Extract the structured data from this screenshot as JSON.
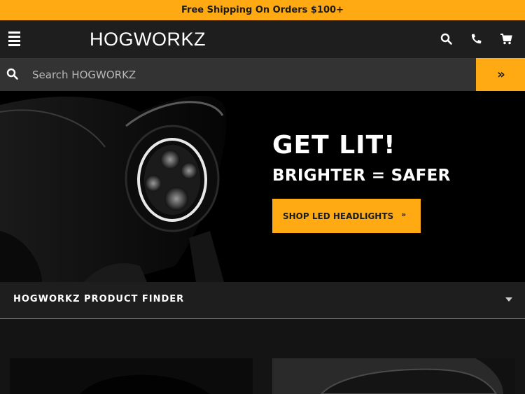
{
  "promo": {
    "text": "Free Shipping On Orders $100+"
  },
  "header": {
    "logo_text": "HOGWORKZ",
    "icons": [
      "menu-icon",
      "search-icon",
      "phone-icon",
      "cart-icon"
    ]
  },
  "search": {
    "placeholder": "Search HOGWORKZ",
    "value": "",
    "submit_label": "»"
  },
  "hero": {
    "title": "GET LIT!",
    "subtitle": "BRIGHTER = SAFER",
    "cta_label": "SHOP LED HEADLIGHTS",
    "cta_arrow": "»"
  },
  "finder": {
    "label": "HOGWORKZ PRODUCT FINDER"
  },
  "colors": {
    "accent": "#ffaa13",
    "header_bg": "#1e1e1e",
    "search_bg": "#333333",
    "page_bg": "#141414"
  }
}
